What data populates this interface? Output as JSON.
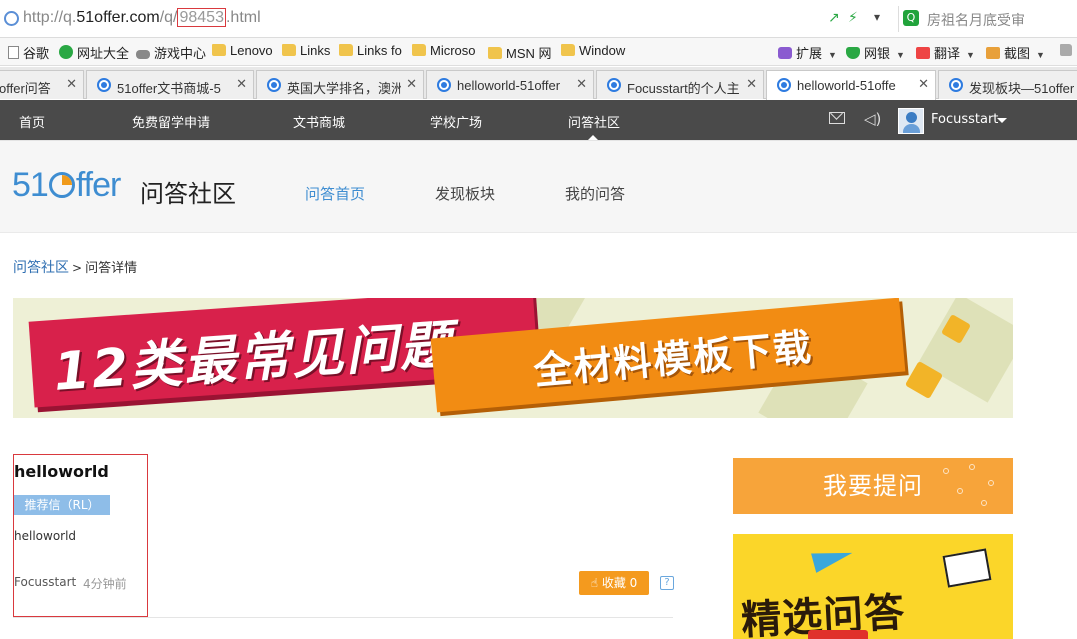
{
  "browser": {
    "url_prefix": "http://q.",
    "url_host": "51offer.com",
    "url_path": "/q/",
    "url_id": "98453",
    "url_suffix": ".html",
    "search_placeholder": "房祖名月底受审",
    "bookmarks": [
      {
        "label": "谷歌",
        "icon": "page-icon"
      },
      {
        "label": "网址大全",
        "icon": "plus-circle-icon"
      },
      {
        "label": "游戏中心",
        "icon": "gamepad-icon"
      },
      {
        "label": "Lenovo",
        "icon": "folder-icon"
      },
      {
        "label": "Links",
        "icon": "folder-icon"
      },
      {
        "label": "Links fo",
        "icon": "folder-icon"
      },
      {
        "label": "Microso",
        "icon": "folder-icon"
      },
      {
        "label": "MSN 网",
        "icon": "folder-icon"
      },
      {
        "label": "Window",
        "icon": "folder-icon"
      }
    ],
    "toolbar_right": [
      {
        "label": "扩展",
        "icon": "extension-icon"
      },
      {
        "label": "网银",
        "icon": "shield-icon"
      },
      {
        "label": "翻译",
        "icon": "translate-icon"
      },
      {
        "label": "截图",
        "icon": "scissors-icon"
      }
    ],
    "tabs": [
      {
        "title": "offer问答"
      },
      {
        "title": "51offer文书商城-5"
      },
      {
        "title": "英国大学排名，澳洲"
      },
      {
        "title": "helloworld-51offer"
      },
      {
        "title": "Focusstart的个人主"
      },
      {
        "title": "helloworld-51offe"
      },
      {
        "title": "发现板块—51offer"
      }
    ]
  },
  "site_nav": {
    "items": [
      "首页",
      "免费留学申请",
      "文书商城",
      "学校广场",
      "问答社区"
    ],
    "active_index": 4,
    "username": "Focusstart"
  },
  "sub_header": {
    "logo": "51offer",
    "section_title": "问答社区",
    "tabs": [
      "问答首页",
      "发现板块",
      "我的问答"
    ],
    "active_tab": 0
  },
  "breadcrumb": {
    "root": "问答社区",
    "separator": ">",
    "current": "问答详情"
  },
  "banner": {
    "headline": "12类最常见问题",
    "subline": "全材料模板下载"
  },
  "question": {
    "title": "helloworld",
    "tag": "推荐信（RL）",
    "body": "helloworld",
    "author": "Focusstart",
    "time": "4分钟前",
    "favorite_label": "收藏",
    "favorite_count": "0",
    "help_icon": "?"
  },
  "sidebar": {
    "ask_button": "我要提问",
    "featured_title": "精选问答"
  },
  "colors": {
    "nav_bg": "#4a4a4a",
    "accent_blue": "#3e8dd1",
    "ask_orange": "#f7a43a",
    "featured_yellow": "#fbd629",
    "highlight_red": "#d9393e"
  }
}
